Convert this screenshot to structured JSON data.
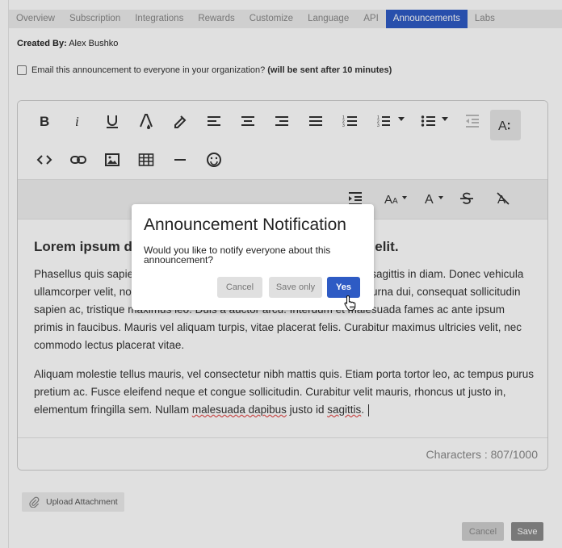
{
  "tabs": [
    {
      "label": "Overview",
      "active": false
    },
    {
      "label": "Subscription",
      "active": false
    },
    {
      "label": "Integrations",
      "active": false
    },
    {
      "label": "Rewards",
      "active": false
    },
    {
      "label": "Customize",
      "active": false
    },
    {
      "label": "Language",
      "active": false
    },
    {
      "label": "API",
      "active": false
    },
    {
      "label": "Announcements",
      "active": true
    },
    {
      "label": "Labs",
      "active": false
    }
  ],
  "created_by": {
    "label": "Created By:",
    "value": "Alex Bushko"
  },
  "email_option": {
    "label": "Email this announcement to everyone in your organization?",
    "note": "(will be sent after 10 minutes)",
    "checked": false
  },
  "toolbar": {
    "row1": [
      "bold-icon",
      "italic-icon",
      "underline-icon",
      "text-color-icon",
      "highlight-icon",
      "align-left-icon",
      "align-center-icon",
      "align-right-icon",
      "justify-icon",
      "ordered-list-icon",
      "bullet-list-icon",
      "outdent-icon",
      "paragraph-format-icon"
    ],
    "row2": [
      "code-view-icon",
      "link-icon",
      "image-icon",
      "table-icon",
      "horizontal-line-icon",
      "emoji-icon"
    ],
    "row3": [
      "indent-icon",
      "font-size-icon",
      "font-family-icon",
      "strikethrough-icon",
      "clear-format-icon"
    ]
  },
  "content": {
    "heading": "Lorem ipsum dolor sit amet, consectetur adipiscing elit.",
    "paragraph1": "Phasellus quis sapien augue. Ut id finibus nunc. Sed malesuada nec, sagittis in diam. Donec vehicula ullamcorper velit, non placerat lectus ante vel, sollicitudin felis. Donec urna dui, consequat sollicitudin sapien ac, tristique maximus leo. Duis a auctor arcu. Interdum et malesuada fames ac ante ipsum primis in faucibus. Mauris vel aliquam turpis, vitae placerat felis. Curabitur maximus ultricies velit, nec commodo lectus placerat vitae.",
    "paragraph2_start": "Aliquam molestie tellus mauris, vel consectetur nibh mattis quis. Etiam porta tortor leo, ac tempus purus pretium ac. Fusce eleifend neque et congue sollicitudin. Curabitur velit mauris, rhoncus ut justo in, elementum fringilla sem. Nullam ",
    "paragraph2_spell1": "malesuada dapibus",
    "paragraph2_mid": " justo id ",
    "paragraph2_spell2": "sagittis",
    "paragraph2_end": "."
  },
  "char_count": "Characters : 807/1000",
  "upload_label": "Upload Attachment",
  "footer": {
    "cancel": "Cancel",
    "save": "Save"
  },
  "modal": {
    "title": "Announcement Notification",
    "message": "Would you like to notify everyone about this announcement?",
    "cancel": "Cancel",
    "save_only": "Save only",
    "yes": "Yes"
  },
  "colors": {
    "accent": "#2e5bc4",
    "tabbar": "#ececec",
    "toolbar_bg": "#efefef"
  }
}
